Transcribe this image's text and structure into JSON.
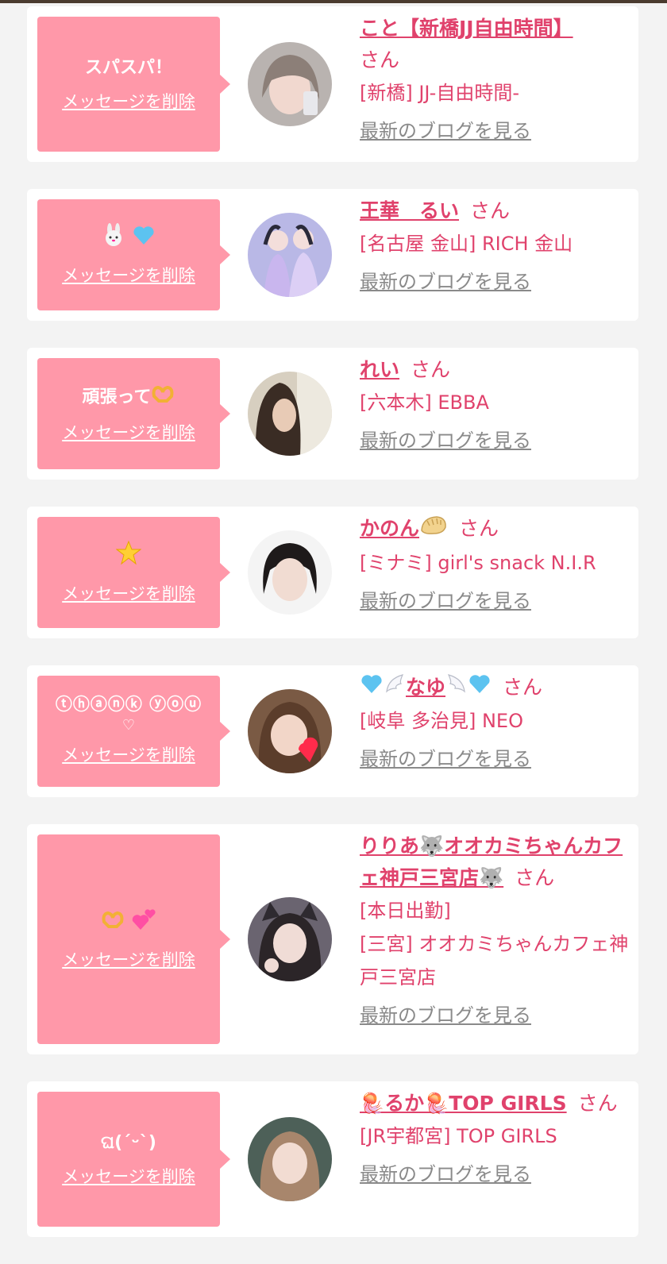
{
  "ui": {
    "delete_label": "メッセージを削除",
    "blog_label": "最新のブログを見る",
    "honorific": "さん"
  },
  "colors": {
    "bubble": "#ff98a9",
    "accent": "#e0426c",
    "link_gray": "#8a8a8a",
    "page_bg": "#f3f3f3"
  },
  "cards": [
    {
      "message": "スパスパ！",
      "name": "こと【新橋JJ自由時間】",
      "shop_lines": [
        "[新橋] JJ-自由時間-"
      ]
    },
    {
      "message": "",
      "message_icons": [
        "rabbit-icon",
        "blue-heart-icon"
      ],
      "name": "王華　るい",
      "shop_lines": [
        "[名古屋 金山] RICH 金山"
      ]
    },
    {
      "message": "頑張って",
      "message_icons": [
        "heart-hands-icon"
      ],
      "name": "れい",
      "shop_lines": [
        "[六本木] EBBA"
      ]
    },
    {
      "message": "",
      "message_icons": [
        "star-icon"
      ],
      "name": "かのん",
      "name_icons": [
        "dumpling-icon"
      ],
      "shop_lines": [
        "[ミナミ] girl's snack N.I.R"
      ]
    },
    {
      "message": "ⓣⓗⓐⓝⓚ ⓨⓞⓤ",
      "message_line2": "♡",
      "name": "なゆ",
      "name_icons": [
        "blue-heart-icon",
        "wing-icon",
        "wing-icon",
        "blue-heart-icon"
      ],
      "shop_lines": [
        "[岐阜 多治見] NEO"
      ]
    },
    {
      "message": "",
      "message_icons": [
        "heart-hands-icon",
        "two-hearts-icon"
      ],
      "name": "りりあ🐺オオカミちゃんカフェ神戸三宮店🐺",
      "shop_lines": [
        "[本日出勤]",
        "[三宮] オオカミちゃんカフェ神戸三宮店"
      ]
    },
    {
      "message": "ଘ(ˊᵕˋ)",
      "name": "🪼るか🪼TOP GIRLS",
      "shop_lines": [
        "[JR宇都宮] TOP GIRLS"
      ]
    }
  ]
}
